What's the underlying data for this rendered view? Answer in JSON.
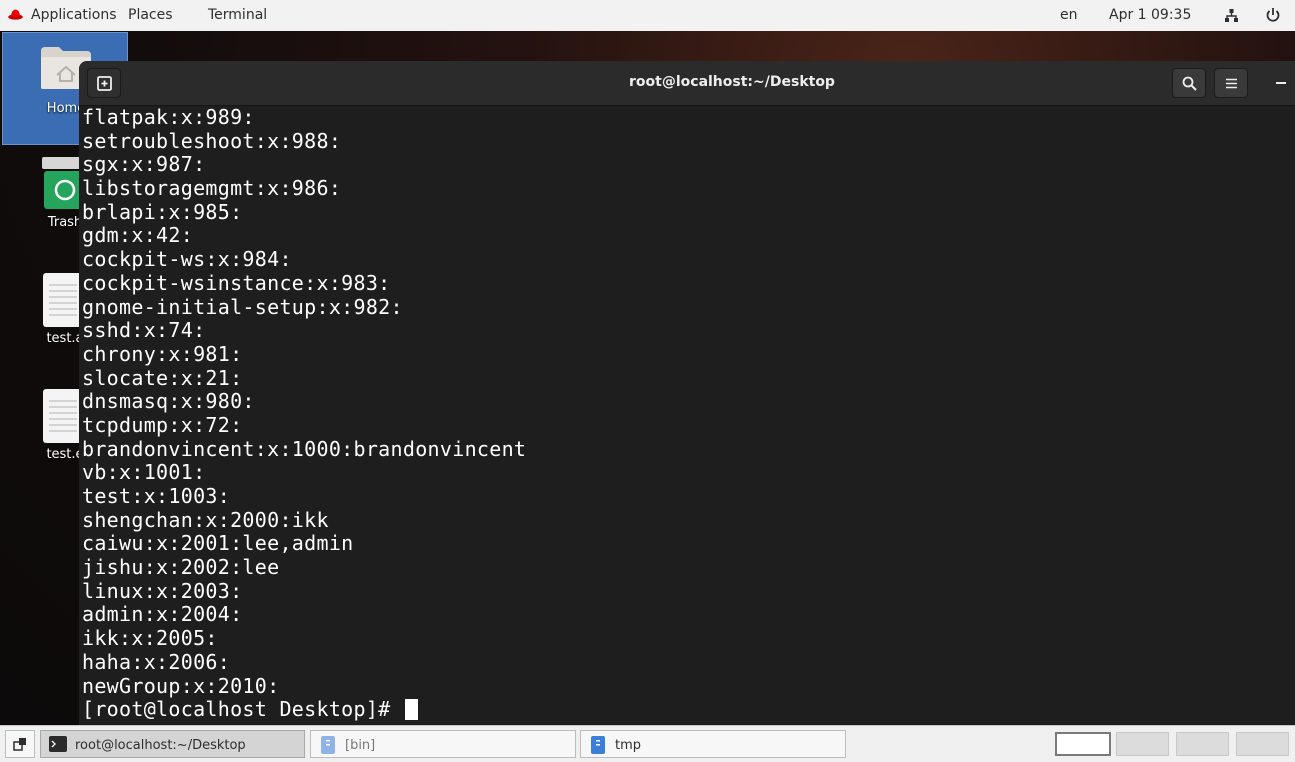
{
  "topbar": {
    "applications": "Applications",
    "places": "Places",
    "terminal": "Terminal",
    "lang": "en",
    "datetime": "Apr 1  09:35"
  },
  "desktop_icons": [
    {
      "label": "Home",
      "icon": "folder-home-icon"
    },
    {
      "label": "Trash",
      "icon": "trash-icon"
    },
    {
      "label": "test.a",
      "icon": "text-file-icon"
    },
    {
      "label": "test.e",
      "icon": "text-file-icon"
    }
  ],
  "terminal": {
    "title": "root@localhost:~/Desktop",
    "lines": [
      "flatpak:x:989:",
      "setroubleshoot:x:988:",
      "sgx:x:987:",
      "libstoragemgmt:x:986:",
      "brlapi:x:985:",
      "gdm:x:42:",
      "cockpit-ws:x:984:",
      "cockpit-wsinstance:x:983:",
      "gnome-initial-setup:x:982:",
      "sshd:x:74:",
      "chrony:x:981:",
      "slocate:x:21:",
      "dnsmasq:x:980:",
      "tcpdump:x:72:",
      "brandonvincent:x:1000:brandonvincent",
      "vb:x:1001:",
      "test:x:1003:",
      "shengchan:x:2000:ikk",
      "caiwu:x:2001:lee,admin",
      "jishu:x:2002:lee",
      "linux:x:2003:",
      "admin:x:2004:",
      "ikk:x:2005:",
      "haha:x:2006:",
      "newGroup:x:2010:"
    ],
    "prompt": "[root@localhost Desktop]# "
  },
  "taskbar": {
    "tasks": [
      {
        "label": "root@localhost:~/Desktop",
        "icon": "terminal-icon",
        "active": true
      },
      {
        "label": "[bin]",
        "icon": "files-icon",
        "active": false
      },
      {
        "label": "tmp",
        "icon": "files-icon",
        "active": false
      }
    ],
    "workspaces": 4
  },
  "colors": {
    "terminal_bg": "#1e1e1e",
    "terminal_fg": "#ffffff",
    "header_bg": "#2b2b2b",
    "topbar_bg": "#f2f2f2",
    "selection_blue": "#3a6db3"
  }
}
